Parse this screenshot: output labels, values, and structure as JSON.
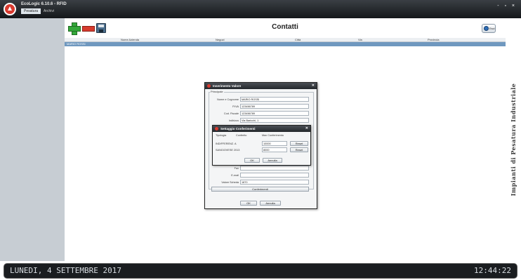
{
  "window": {
    "title": "EcoLogic 6.10.6 - RFID",
    "tabs": [
      "Pesatura",
      "Archivi"
    ],
    "controls": "- ▫ ×"
  },
  "toolbar": {
    "page_title": "Contatti",
    "exit_label": "Esci"
  },
  "grid": {
    "columns": [
      "Nome Azienda",
      "Negozi",
      "Città",
      "Via",
      "Provincia"
    ],
    "rows": [
      [
        "MARIO ROSSI",
        "",
        "",
        "",
        ""
      ]
    ]
  },
  "brand_text": "Impianti di Pesatura Industriale",
  "status": {
    "date": "LUNEDI, 4 SETTEMBRE 2017",
    "time": "12:44:22"
  },
  "dialog_main": {
    "title": "Inserimento Valore",
    "group_label": "Principale",
    "fields": [
      {
        "label": "Nome e Cognome",
        "value": "MARIO ROSSI"
      },
      {
        "label": "P.IVA",
        "value": "123456789"
      },
      {
        "label": "Cod. Fiscale",
        "value": "123456789"
      },
      {
        "label": "Indirizzo",
        "value": "Via Baricchi, 1"
      }
    ],
    "fields_bottom": [
      {
        "label": "Fax",
        "value": ""
      },
      {
        "label": "E-mail",
        "value": ""
      },
      {
        "label": "Valore Scheda",
        "value": "1870"
      }
    ],
    "confirm_label": "Conferimenti",
    "ok_label": "OK",
    "cancel_label": "Annulla"
  },
  "dialog_sub": {
    "title": "Settaggio Conferimenti",
    "headers": [
      "Tipologia",
      "Conferito",
      "Max Conferimento"
    ],
    "rows": [
      {
        "type": "INDIFFERENZ. A",
        "max": "10000",
        "button": "Reset"
      },
      {
        "type": "SANGIOVESE 2013",
        "max": "8000",
        "button": "Reset"
      }
    ],
    "ok_label": "OK",
    "cancel_label": "Annulla"
  }
}
